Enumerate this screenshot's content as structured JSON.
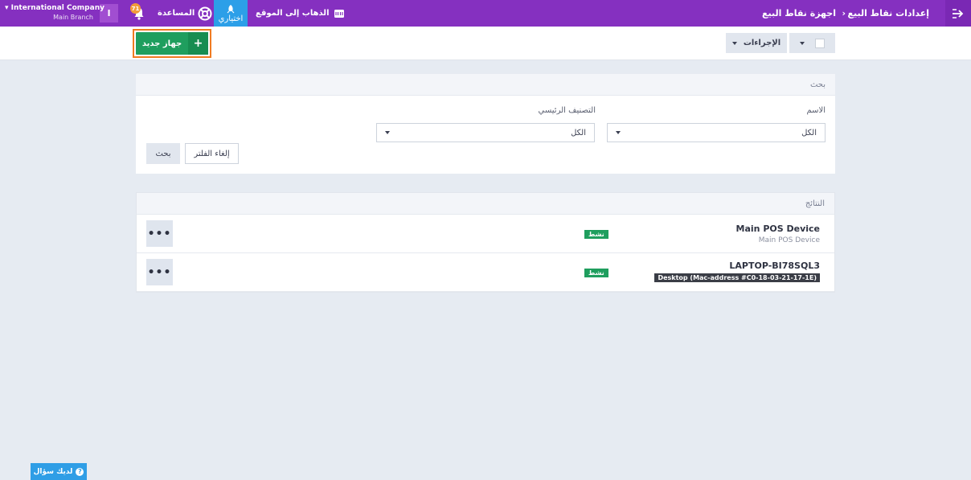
{
  "topbar": {
    "breadcrumb_parent": "إعدادات نقاط البيع",
    "breadcrumb_current": "اجهزة نقاط البيع",
    "go_to_site": "الذهاب إلى الموقع",
    "shortcuts": "اختياري",
    "help": "المساعدة",
    "notifications_count": "71",
    "avatar_letter": "I",
    "company_name": "International Company",
    "branch_name": "Main Branch"
  },
  "toolbar": {
    "new_device": "جهاز جديد",
    "actions": "الإجراءات"
  },
  "search": {
    "title": "بحث",
    "name_label": "الاسم",
    "name_value": "الكل",
    "category_label": "التصنيف الرئيسي",
    "category_value": "الكل",
    "search_button": "بحث",
    "clear_filter_button": "إلغاء الفلتر"
  },
  "results": {
    "title": "النتائج",
    "rows": [
      {
        "name": "Main POS Device",
        "subtitle": "Main POS Device",
        "status": "نشط"
      },
      {
        "name": "LAPTOP-BI78SQL3",
        "subtitle": "Desktop (Mac-address #C0-18-03-21-17-1E)",
        "status": "نشط"
      }
    ]
  },
  "help_widget": {
    "label": "لديك سؤال"
  },
  "colors": {
    "topbar": "#8530c0",
    "primary_green": "#1f9e5e",
    "highlight_orange": "#f07b21",
    "shortcut_blue": "#2c9fe8"
  }
}
